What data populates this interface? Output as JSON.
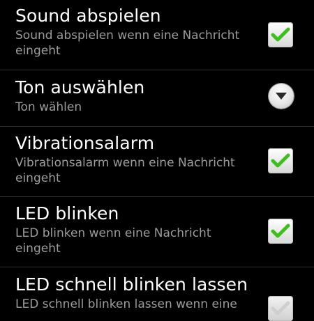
{
  "settings": [
    {
      "title": "Sound abspielen",
      "summary": "Sound abspielen wenn eine Nachricht eingeht",
      "control": "checkbox",
      "checked": true
    },
    {
      "title": "Ton auswählen",
      "summary": "Ton wählen",
      "control": "dropdown",
      "icon": "chevron-down-icon"
    },
    {
      "title": "Vibrationsalarm",
      "summary": "Vibrationsalarm wenn eine Nachricht eingeht",
      "control": "checkbox",
      "checked": true
    },
    {
      "title": "LED blinken",
      "summary": "LED blinken wenn eine Nachricht eingeht",
      "control": "checkbox",
      "checked": true
    },
    {
      "title": "LED schnell blinken lassen",
      "summary": "LED schnell blinken lassen wenn eine",
      "control": "checkbox",
      "checked": false
    }
  ],
  "colors": {
    "background": "#000000",
    "title": "#ffffff",
    "summary": "#9c9c9c",
    "check_green": "#3fbf1f",
    "check_unchecked": "#cfcfcf",
    "divider": "#2e2e2e"
  }
}
